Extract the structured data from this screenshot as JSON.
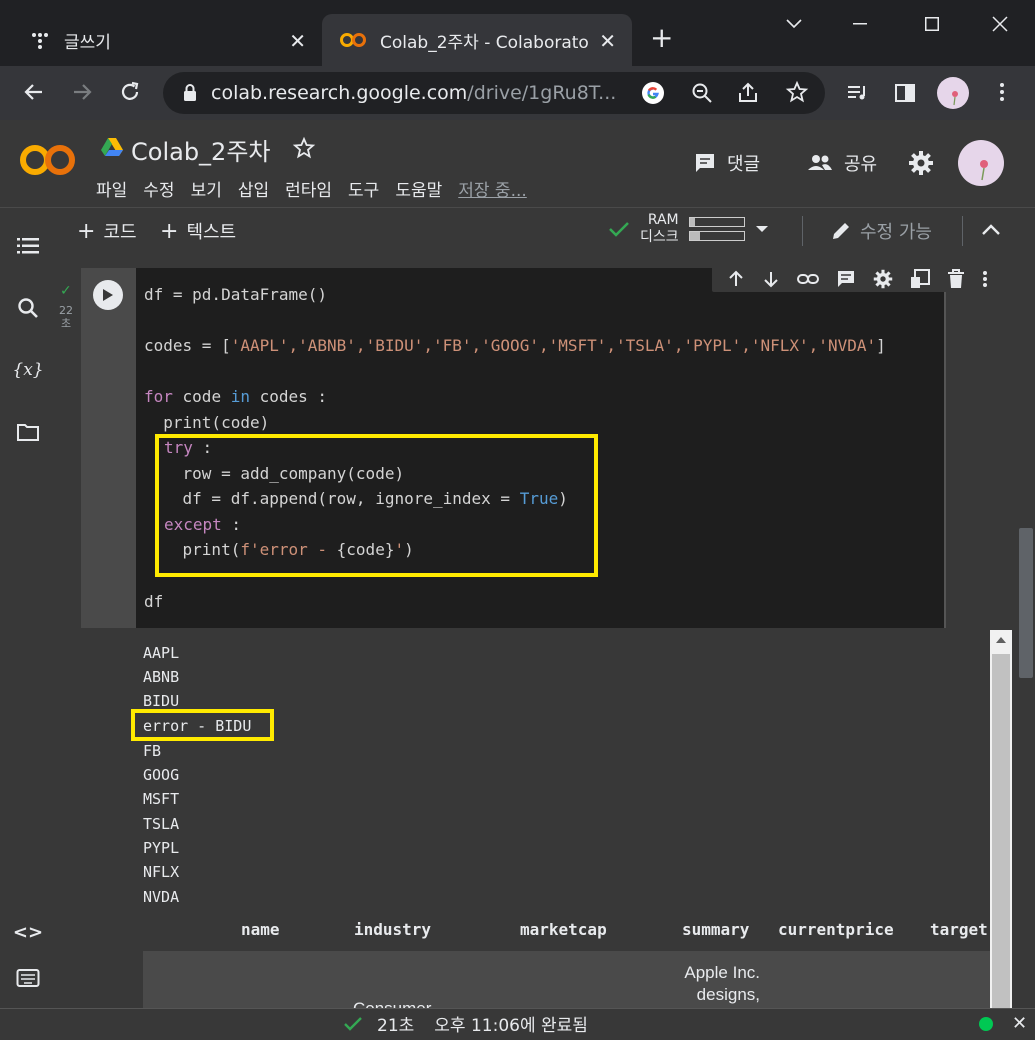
{
  "browser": {
    "tabs": [
      {
        "title": "글쓰기",
        "icon": "tistory-dots-icon",
        "active": false
      },
      {
        "title": "Colab_2주차 - Colaborato",
        "icon": "colab-logo-icon",
        "active": true
      }
    ],
    "address": {
      "host": "colab.research.google.com",
      "path": "/drive/1gRu8T..."
    }
  },
  "colab": {
    "logo": "CO",
    "notebook_title": "Colab_2주차",
    "menu": [
      "파일",
      "수정",
      "보기",
      "삽입",
      "런타임",
      "도구",
      "도움말"
    ],
    "saving_status": "저장 중...",
    "comment_label": "댓글",
    "share_label": "공유",
    "add_code": "코드",
    "add_text": "텍스트",
    "ram_label": "RAM",
    "disk_label": "디스크",
    "ram_usage": 0.1,
    "disk_usage": 0.2,
    "edit_mode": "수정 가능",
    "accent_color": "#f9ab00"
  },
  "cell": {
    "exec_time": "22\n초",
    "code_lines": {
      "l1": "df = pd.DataFrame()",
      "l2_prefix": "codes = [",
      "l2_list": "'AAPL','ABNB','BIDU','FB','GOOG','MSFT','TSLA','PYPL','NFLX','NVDA'",
      "l2_suffix": "]",
      "l3_for": "for",
      "l3_mid": " code ",
      "l3_in": "in",
      "l3_rest": " codes :",
      "l4": "  print(code)",
      "l5_try": "try",
      "l5_rest": " :",
      "l6": "    row = add_company(code)",
      "l7_pre": "    df = df.append(row, ignore_index = ",
      "l7_true": "True",
      "l7_post": ")",
      "l8_except": "except",
      "l8_rest": " :",
      "l9_pre": "    print(",
      "l9_str": "f'error - ",
      "l9_var": "{code}",
      "l9_end": "'",
      "l9_close": ")",
      "l10": "df"
    }
  },
  "output": {
    "lines": [
      "AAPL",
      "ABNB",
      "BIDU",
      "error - BIDU",
      "FB",
      "GOOG",
      "MSFT",
      "TSLA",
      "PYPL",
      "NFLX",
      "NVDA"
    ],
    "table_headers": [
      "name",
      "industry",
      "marketcap",
      "summary",
      "currentprice",
      "target"
    ],
    "row0_industry": "Consumer",
    "row0_summary_1": "Apple Inc.",
    "row0_summary_2": "designs,"
  },
  "status": {
    "elapsed": "21초",
    "completed": "오후 11:06에 완료됨"
  }
}
